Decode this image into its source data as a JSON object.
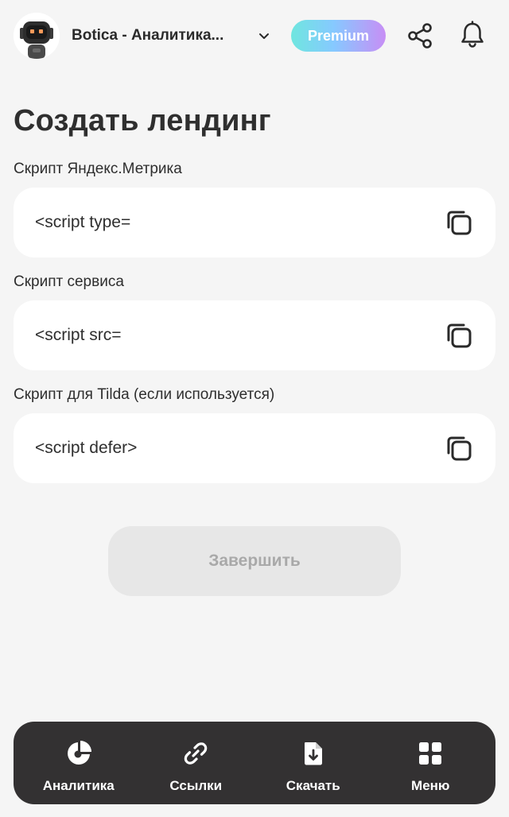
{
  "header": {
    "workspace_name": "Botica - Аналитика...",
    "premium_label": "Premium"
  },
  "page": {
    "title": "Создать лендинг"
  },
  "fields": [
    {
      "label": "Скрипт Яндекс.Метрика",
      "value": "<script type="
    },
    {
      "label": "Скрипт сервиса",
      "value": "<script src="
    },
    {
      "label": "Скрипт для Tilda (если используется)",
      "value": "<script defer>"
    }
  ],
  "finish_label": "Завершить",
  "nav": {
    "items": [
      {
        "label": "Аналитика",
        "icon": "pie-chart-icon"
      },
      {
        "label": "Ссылки",
        "icon": "link-icon"
      },
      {
        "label": "Скачать",
        "icon": "download-file-icon"
      },
      {
        "label": "Меню",
        "icon": "grid-menu-icon"
      }
    ]
  },
  "colors": {
    "background": "#f5f5f5",
    "nav_background": "#333132",
    "card_background": "#ffffff",
    "disabled_button": "#e7e7e7",
    "disabled_text": "#a9a9a9"
  }
}
